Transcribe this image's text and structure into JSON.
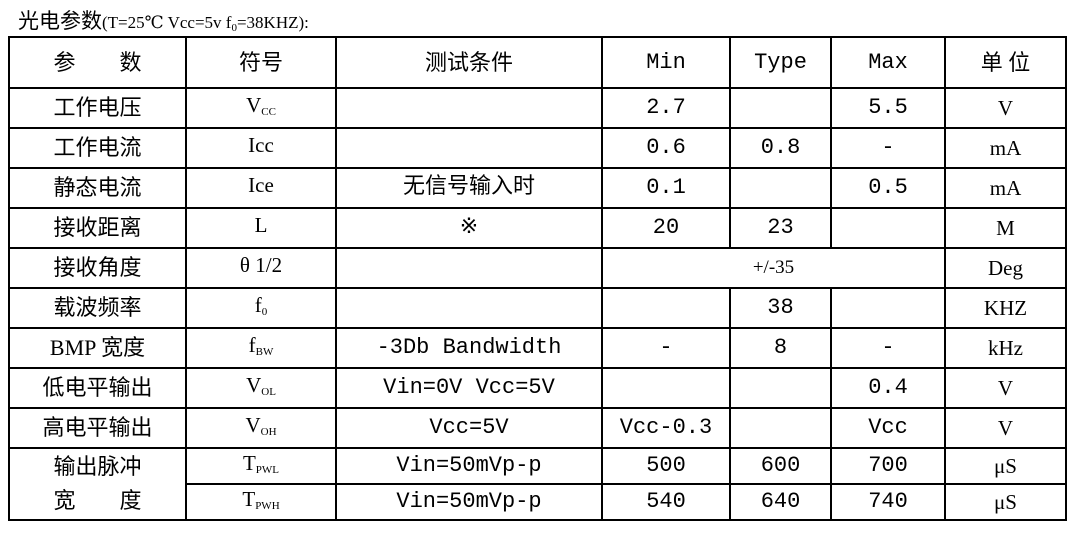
{
  "title": {
    "main": "光电参数",
    "cond": "(T=25℃  Vcc=5v  f",
    "cond_sub": "0",
    "cond_end": "=38KHZ):"
  },
  "headers": [
    "参　　数",
    "符号",
    "测试条件",
    "Min",
    "Type",
    "Max",
    "单 位"
  ],
  "rows": [
    {
      "param": "工作电压",
      "sym": "V",
      "sub": "CC",
      "cond": "",
      "min": "2.7",
      "typ": "",
      "max": "5.5",
      "unit": "V"
    },
    {
      "param": "工作电流",
      "sym": "Icc",
      "sub": "",
      "cond": "",
      "min": "0.6",
      "typ": "0.8",
      "max": "-",
      "unit": "mA"
    },
    {
      "param": "静态电流",
      "sym": "Ice",
      "sub": "",
      "cond": "无信号输入时",
      "min": "0.1",
      "typ": "",
      "max": "0.5",
      "unit": "mA"
    },
    {
      "param": "接收距离",
      "sym": "L",
      "sub": "",
      "cond": "※",
      "min": "20",
      "typ": "23",
      "max": "",
      "unit": "M"
    },
    {
      "param": "接收角度",
      "sym": "θ 1/2",
      "sub": "",
      "cond": "",
      "merged": "+/-35",
      "unit": "Deg"
    },
    {
      "param": "载波频率",
      "sym": "f",
      "sub": "0",
      "cond": "",
      "min": "",
      "typ": "38",
      "max": "",
      "unit": "KHZ"
    },
    {
      "param": "BMP 宽度",
      "sym": "f",
      "sub": "BW",
      "cond": "-3Db Bandwidth",
      "min": "-",
      "typ": "8",
      "max": "-",
      "unit": "kHz"
    },
    {
      "param": "低电平输出",
      "sym": "V",
      "sub": "OL",
      "cond": "Vin=0V  Vcc=5V",
      "min": "",
      "typ": "",
      "max": "0.4",
      "unit": "V"
    },
    {
      "param": "高电平输出",
      "sym": "V",
      "sub": "OH",
      "cond": "Vcc=5V",
      "min": "Vcc-0.3",
      "typ": "",
      "max": "Vcc",
      "unit": "V"
    }
  ],
  "pulse": {
    "param_line1": "输出脉冲",
    "param_line2": "宽　　度",
    "rows": [
      {
        "sym": "T",
        "sub": "PWL",
        "cond": "Vin=50mVp-p",
        "min": "500",
        "typ": "600",
        "max": "700",
        "unit": "μS"
      },
      {
        "sym": "T",
        "sub": "PWH",
        "cond": "Vin=50mVp-p",
        "min": "540",
        "typ": "640",
        "max": "740",
        "unit": "μS"
      }
    ]
  }
}
